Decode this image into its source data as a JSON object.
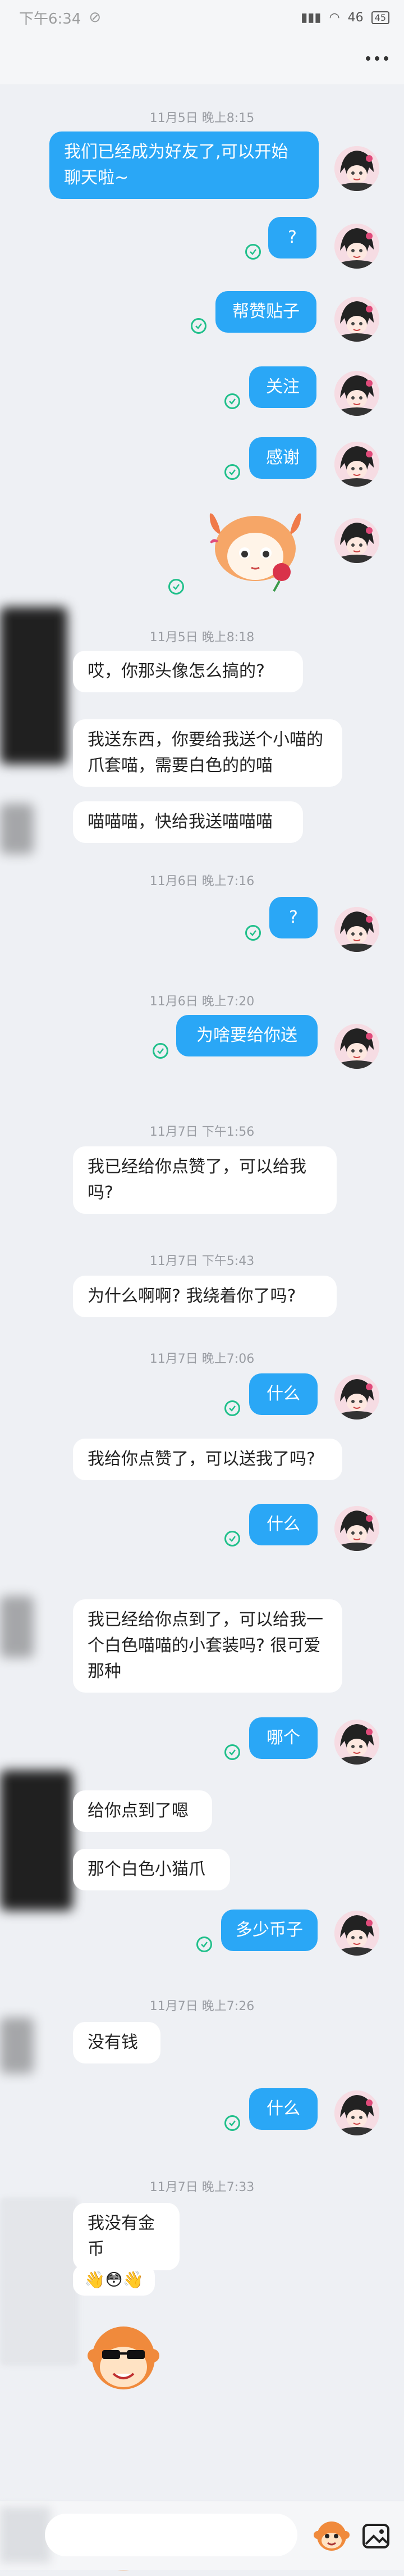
{
  "status_bar": {
    "time": "下午6:34",
    "indicator": "⊘",
    "signal": "46",
    "battery": "45"
  },
  "header": {
    "more_icon": "more-dots-icon"
  },
  "timestamps": [
    "11月5日 晚上8:15",
    "11月5日 晚上8:18",
    "11月6日 晚上7:16",
    "11月6日 晚上7:20",
    "11月7日 下午1:56",
    "11月7日 下午5:43",
    "11月7日 晚上7:06",
    "11月7日 晚上7:26",
    "11月7日 晚上7:33"
  ],
  "messages": {
    "m1": "我们已经成为好友了,可以开始聊天啦~",
    "m2": "?",
    "m3": "帮赞贴子",
    "m4": "关注",
    "m5": "感谢",
    "m6": "哎，你那头像怎么搞的?",
    "m7": "我送东西，你要给我送个小喵的爪套喵，需要白色的的喵",
    "m8": "喵喵喵，快给我送喵喵喵",
    "m9": "?",
    "m10": "为啥要给你送",
    "m11": "我已经给你点赞了，可以给我吗?",
    "m12": "为什么啊啊? 我绕着你了吗?",
    "m13": "什么",
    "m14": "我给你点赞了，可以送我了吗?",
    "m15": "什么",
    "m16": "我已经给你点到了，可以给我一个白色喵喵的小套装吗? 很可爱那种",
    "m17": "哪个",
    "m18": "给你点到了嗯",
    "m19": "那个白色小猫爪",
    "m20": "多少币子",
    "m21": "没有钱",
    "m22": "什么",
    "m23": "我没有金币",
    "m24": "👋😳👋"
  },
  "input": {
    "placeholder": ""
  },
  "icons": {
    "read": "read-check-icon",
    "emoji": "emoji-sticker-icon",
    "image": "image-icon",
    "avatar": "anime-avatar-icon"
  },
  "colors": {
    "outgoing_bubble": "#2aa7f6",
    "incoming_bubble": "#ffffff",
    "background": "#eef0f4",
    "read_check": "#21c08b",
    "timestamp": "#9a9da3"
  }
}
